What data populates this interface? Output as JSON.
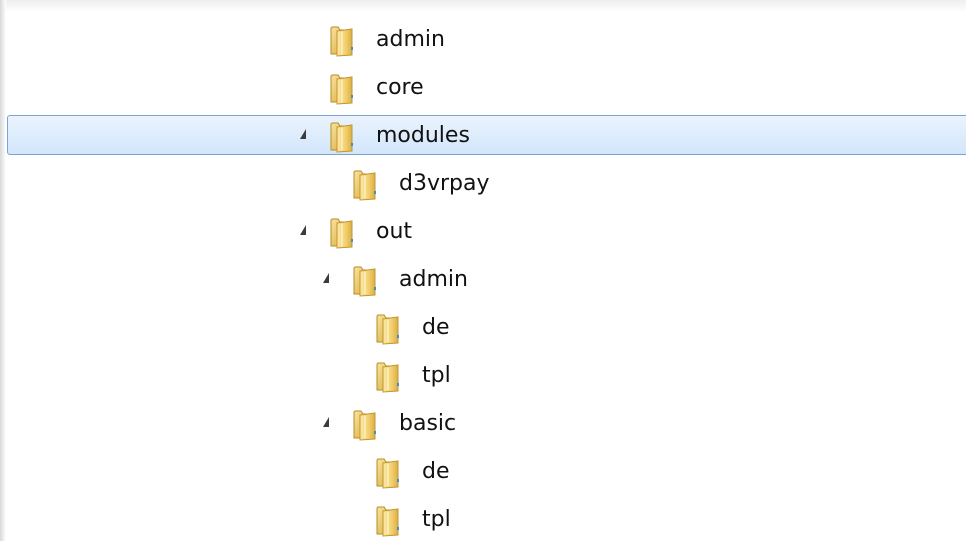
{
  "tree": {
    "items": [
      {
        "label": "admin",
        "depth": 0,
        "expandable": false,
        "expanded": false,
        "selected": false
      },
      {
        "label": "core",
        "depth": 0,
        "expandable": false,
        "expanded": false,
        "selected": false
      },
      {
        "label": "modules",
        "depth": 0,
        "expandable": true,
        "expanded": true,
        "selected": true
      },
      {
        "label": "d3vrpay",
        "depth": 1,
        "expandable": false,
        "expanded": false,
        "selected": false
      },
      {
        "label": "out",
        "depth": 0,
        "expandable": true,
        "expanded": true,
        "selected": false
      },
      {
        "label": "admin",
        "depth": 1,
        "expandable": true,
        "expanded": true,
        "selected": false
      },
      {
        "label": "de",
        "depth": 2,
        "expandable": false,
        "expanded": false,
        "selected": false
      },
      {
        "label": "tpl",
        "depth": 2,
        "expandable": false,
        "expanded": false,
        "selected": false
      },
      {
        "label": "basic",
        "depth": 1,
        "expandable": true,
        "expanded": true,
        "selected": false
      },
      {
        "label": "de",
        "depth": 2,
        "expandable": false,
        "expanded": false,
        "selected": false
      },
      {
        "label": "tpl",
        "depth": 2,
        "expandable": false,
        "expanded": false,
        "selected": false
      }
    ]
  },
  "icons": {
    "folder": "folder-icon",
    "expander": "expanded-triangle-icon"
  },
  "colors": {
    "selection_border": "#7da2ce",
    "selection_fill": "#d8e9fc",
    "folder_yellow": "#f2cf6a",
    "text": "#111111"
  }
}
